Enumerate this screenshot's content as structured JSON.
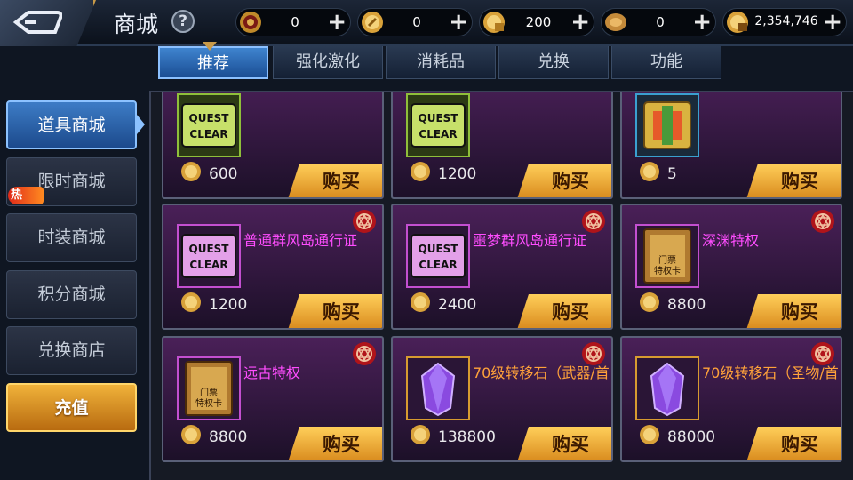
{
  "header": {
    "title": "商城",
    "help_glyph": "?",
    "currencies": [
      {
        "icon": "red-token-icon",
        "value": "0"
      },
      {
        "icon": "gold-coin-icon",
        "value": "0"
      },
      {
        "icon": "bound-gold-coin-icon",
        "value": "200"
      },
      {
        "icon": "bronze-coin-icon",
        "value": "0"
      },
      {
        "icon": "locked-gold-coin-icon",
        "value": "2,354,746"
      }
    ],
    "plus": "+"
  },
  "tabs": [
    {
      "label": "推荐",
      "active": true
    },
    {
      "label": "强化激化",
      "active": false
    },
    {
      "label": "消耗品",
      "active": false
    },
    {
      "label": "兑换",
      "active": false
    },
    {
      "label": "功能",
      "active": false
    }
  ],
  "sidebar": {
    "items": [
      {
        "label": "道具商城",
        "active": true
      },
      {
        "label": "限时商城",
        "badge": "热"
      },
      {
        "label": "时装商城"
      },
      {
        "label": "积分商城"
      },
      {
        "label": "兑换商店"
      },
      {
        "label": "充值",
        "highlight": true
      }
    ]
  },
  "buy_label": "购买",
  "items": [
    {
      "name": "",
      "price": "600",
      "icon": "quest-clear-ticket-green-icon"
    },
    {
      "name": "",
      "price": "1200",
      "icon": "quest-clear-ticket-green-icon"
    },
    {
      "name": "",
      "price": "5",
      "icon": "golden-box-icon"
    },
    {
      "name": "普通群风岛通行证",
      "price": "1200",
      "icon": "quest-clear-ticket-purple-icon",
      "seal": true
    },
    {
      "name": "噩梦群风岛通行证",
      "price": "2400",
      "icon": "quest-clear-ticket-purple-icon",
      "seal": true
    },
    {
      "name": "深渊特权",
      "price": "8800",
      "icon": "privilege-card-icon",
      "seal": true
    },
    {
      "name": "远古特权",
      "price": "8800",
      "icon": "privilege-card-icon",
      "seal": true
    },
    {
      "name": "70级转移石（武器/首",
      "price": "138800",
      "icon": "purple-crystal-icon",
      "seal": true
    },
    {
      "name": "70级转移石（圣物/首",
      "price": "88000",
      "icon": "purple-crystal-icon",
      "seal": true
    }
  ],
  "icon_text": {
    "quest": "QUEST",
    "clear": "CLEAR",
    "card_line1": "门票",
    "card_line2": "特权卡"
  },
  "colors": {
    "accent_blue": "#3f84cf",
    "buy_gold": "#ffcf5a",
    "item_name_pink": "#ff4dff",
    "item_name_orange": "#ffa23a"
  }
}
